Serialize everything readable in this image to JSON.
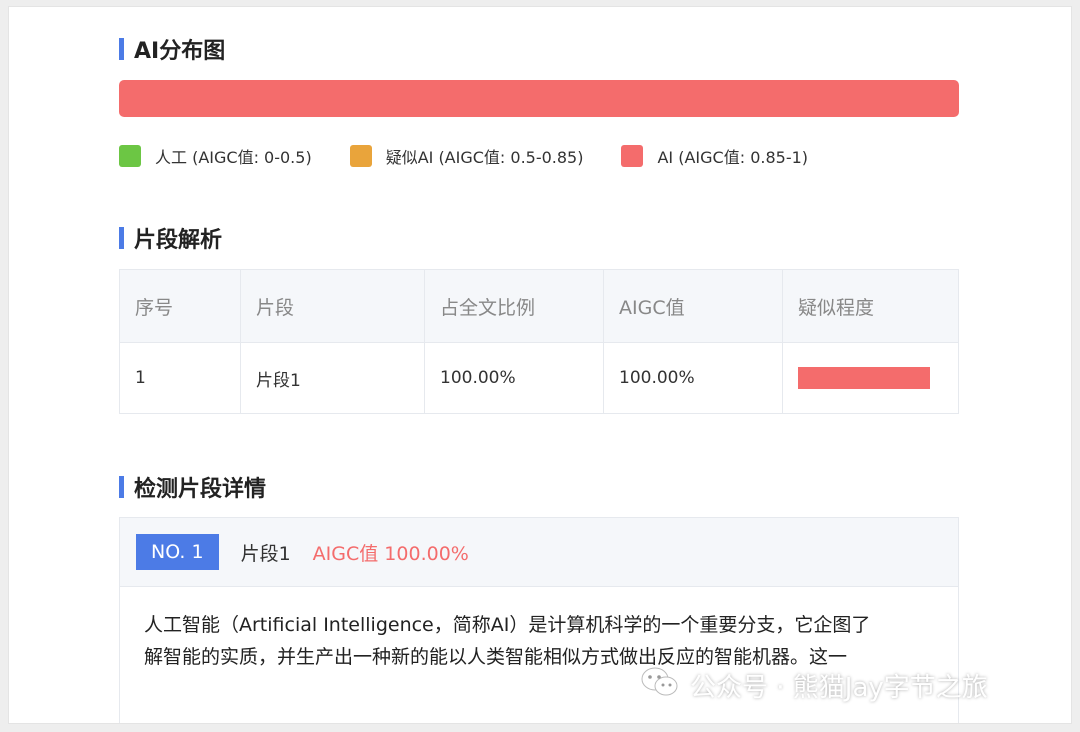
{
  "distribution": {
    "title": "AI分布图",
    "bar_color": "#f46c6c",
    "legend": [
      {
        "label": "人工 (AIGC值: 0-0.5)",
        "color": "#6cc644"
      },
      {
        "label": "疑似AI (AIGC值: 0.5-0.85)",
        "color": "#e9a43b"
      },
      {
        "label": "AI (AIGC值: 0.85-1)",
        "color": "#f46c6c"
      }
    ]
  },
  "segments": {
    "title": "片段解析",
    "headers": [
      "序号",
      "片段",
      "占全文比例",
      "AIGC值",
      "疑似程度"
    ],
    "rows": [
      {
        "index": "1",
        "segment": "片段1",
        "ratio": "100.00%",
        "aigc": "100.00%",
        "level": 1.0
      }
    ]
  },
  "details": {
    "title": "检测片段详情",
    "items": [
      {
        "badge": "NO. 1",
        "segment": "片段1",
        "aigc": "AIGC值 100.00%",
        "text_line1": "人工智能（Artificial Intelligence，简称AI）是计算机科学的一个重要分支，它企图了",
        "text_line2": "解智能的实质，并生产出一种新的能以人类智能相似方式做出反应的智能机器。这一"
      }
    ]
  },
  "watermark": {
    "icon": "wechat-icon",
    "text": "公众号 · 熊猫Jay字节之旅"
  },
  "colors": {
    "accent": "#4c7be6",
    "ai_red": "#f46c6c"
  }
}
